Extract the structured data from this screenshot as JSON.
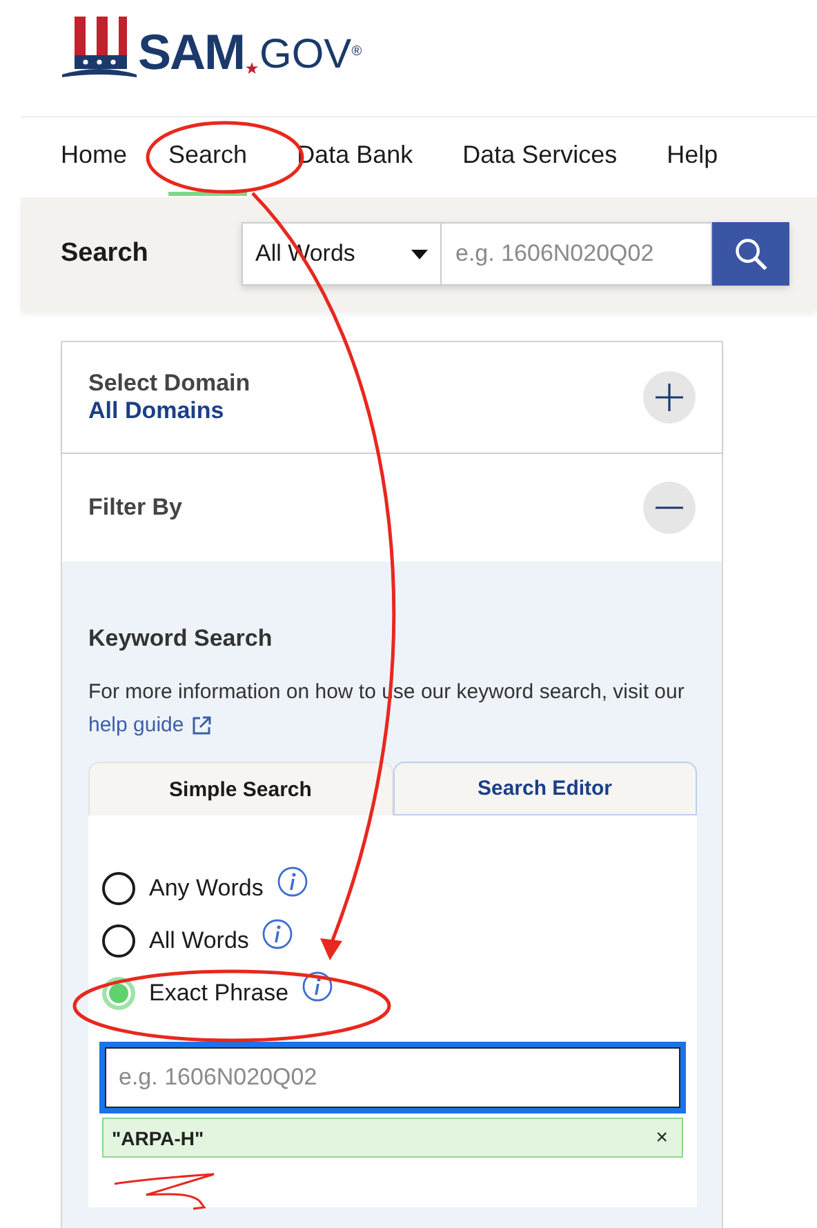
{
  "logo": {
    "name": "SAM",
    "domain": "GOV",
    "mark": "®"
  },
  "nav": [
    {
      "label": "Home",
      "selected": false
    },
    {
      "label": "Search",
      "selected": true
    },
    {
      "label": "Data Bank",
      "selected": false
    },
    {
      "label": "Data Services",
      "selected": false
    },
    {
      "label": "Help",
      "selected": false
    }
  ],
  "search_bar": {
    "label": "Search",
    "mode": "All Words",
    "placeholder": "e.g. 1606N020Q02"
  },
  "domain": {
    "title": "Select Domain",
    "value": "All Domains",
    "expanded": false
  },
  "filter": {
    "title": "Filter By",
    "expanded": true
  },
  "keyword": {
    "title": "Keyword Search",
    "info": "For more information on how to use our keyword search, visit our",
    "link": "help guide",
    "tabs": [
      {
        "label": "Simple Search",
        "selected": true
      },
      {
        "label": "Search Editor",
        "selected": false
      }
    ],
    "options": [
      {
        "label": "Any Words",
        "selected": false
      },
      {
        "label": "All Words",
        "selected": false
      },
      {
        "label": "Exact Phrase",
        "selected": true
      }
    ],
    "input": {
      "placeholder": "e.g. 1606N020Q02"
    },
    "chips": [
      {
        "label": "\"ARPA-H\"",
        "remove": "×"
      }
    ]
  }
}
